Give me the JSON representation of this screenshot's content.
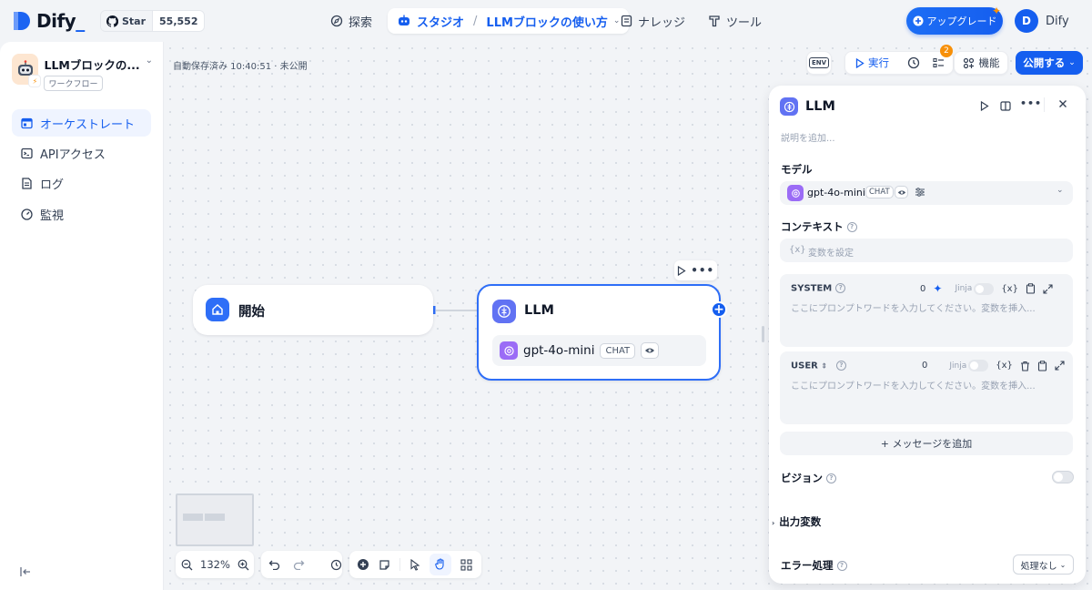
{
  "topbar": {
    "logo_text": "Dify",
    "github": {
      "star_label": "Star",
      "star_count": "55,552"
    },
    "nav": {
      "explore": "探索",
      "studio": "スタジオ",
      "app_name": "LLMブロックの使い方",
      "knowledge": "ナレッジ",
      "tools": "ツール"
    },
    "upgrade_label": "アップグレード",
    "user": {
      "initial": "D",
      "name": "Dify"
    }
  },
  "sidebar": {
    "app_title": "LLMブロックの...",
    "app_type": "ワークフロー",
    "items": [
      {
        "label": "オーケストレート",
        "active": true
      },
      {
        "label": "APIアクセス"
      },
      {
        "label": "ログ"
      },
      {
        "label": "監視"
      }
    ]
  },
  "canvas": {
    "autosave": "自動保存済み 10:40:51 · 未公開",
    "toolbar": {
      "env": "ENV",
      "run": "実行",
      "checklist_count": "2",
      "features": "機能",
      "publish": "公開する"
    },
    "nodes": {
      "start_title": "開始",
      "llm_title": "LLM",
      "model_name": "gpt-4o-mini",
      "model_mode": "CHAT"
    },
    "zoom": "132%"
  },
  "panel": {
    "title": "LLM",
    "description_placeholder": "説明を追加...",
    "model_label": "モデル",
    "model_name": "gpt-4o-mini",
    "model_mode": "CHAT",
    "context_label": "コンテキスト",
    "context_placeholder": "変数を設定",
    "system": {
      "role": "SYSTEM",
      "count": "0",
      "jinja": "Jinja",
      "placeholder": "ここにプロンプトワードを入力してください。変数を挿入..."
    },
    "user": {
      "role": "USER",
      "count": "0",
      "jinja": "Jinja",
      "placeholder": "ここにプロンプトワードを入力してください。変数を挿入..."
    },
    "add_message": "+ メッセージを追加",
    "vision_label": "ビジョン",
    "output_vars_label": "出力変数",
    "error_handling_label": "エラー処理",
    "error_handling_value": "処理なし"
  },
  "colors": {
    "accent": "#155eef",
    "node_border": "#2e6ef7",
    "llm_icon": "#6172f3",
    "start_icon": "#2e6ef7"
  }
}
